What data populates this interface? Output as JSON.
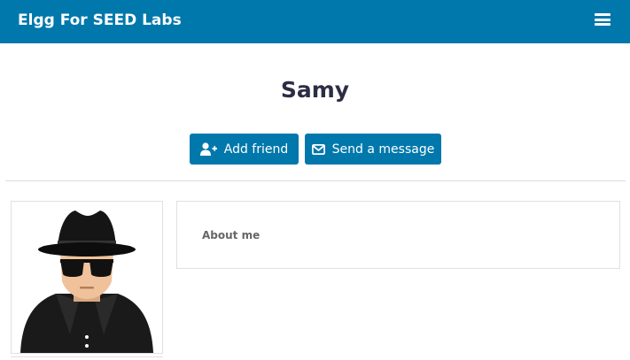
{
  "header": {
    "site_name": "Elgg For SEED Labs",
    "menu_icon": "hamburger-menu-icon",
    "background_color": "#0078ac"
  },
  "profile": {
    "name": "Samy",
    "avatar_icon": "spy-avatar-icon"
  },
  "actions": {
    "add_friend_label": "Add friend",
    "add_friend_icon": "user-plus-icon",
    "send_message_label": "Send a message",
    "send_message_icon": "envelope-icon",
    "button_color": "#0078ac"
  },
  "about": {
    "label": "About me"
  }
}
